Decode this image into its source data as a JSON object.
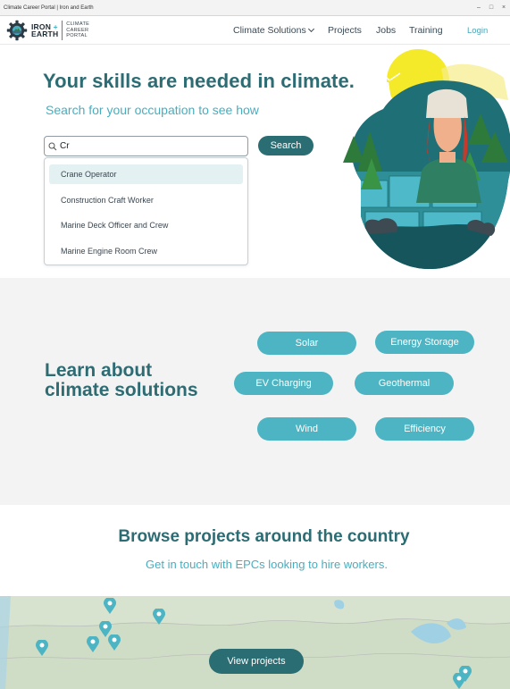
{
  "window": {
    "title": "Climate Career Portal | Iron and Earth",
    "min_label": "–",
    "max_label": "□",
    "close_label": "×"
  },
  "header": {
    "logo": {
      "line1": "IRON",
      "plus": "+",
      "line2": "EARTH",
      "sub": [
        "CLIMATE",
        "CAREER",
        "PORTAL"
      ]
    },
    "nav": [
      "Climate Solutions",
      "Projects",
      "Jobs",
      "Training"
    ],
    "login": "Login"
  },
  "hero": {
    "title": "Your skills are needed in climate.",
    "subtitle": "Search for your occupation to see how",
    "search_value": "Cr",
    "search_button": "Search",
    "suggestions": [
      "Crane Operator",
      "Construction Craft Worker",
      "Marine Deck Officer and Crew",
      "Marine Engine Room Crew"
    ]
  },
  "solutions": {
    "title_line1": "Learn about",
    "title_line2": "climate solutions",
    "items": [
      "Solar",
      "Energy Storage",
      "EV Charging",
      "Geothermal",
      "Wind",
      "Efficiency"
    ]
  },
  "projects": {
    "title": "Browse projects around the country",
    "subtitle": "Get in touch with EPCs looking to hire workers.",
    "button": "View projects"
  },
  "colors": {
    "brand_dark": "#2a6d73",
    "brand_light": "#4cb4c3",
    "heading": "#2d6c73",
    "subheading": "#47aebf"
  },
  "icons": {
    "logo": "gear-logo-icon",
    "search": "search-icon",
    "dropdown": "chevron-down-icon",
    "map_marker": "map-pin-icon"
  }
}
